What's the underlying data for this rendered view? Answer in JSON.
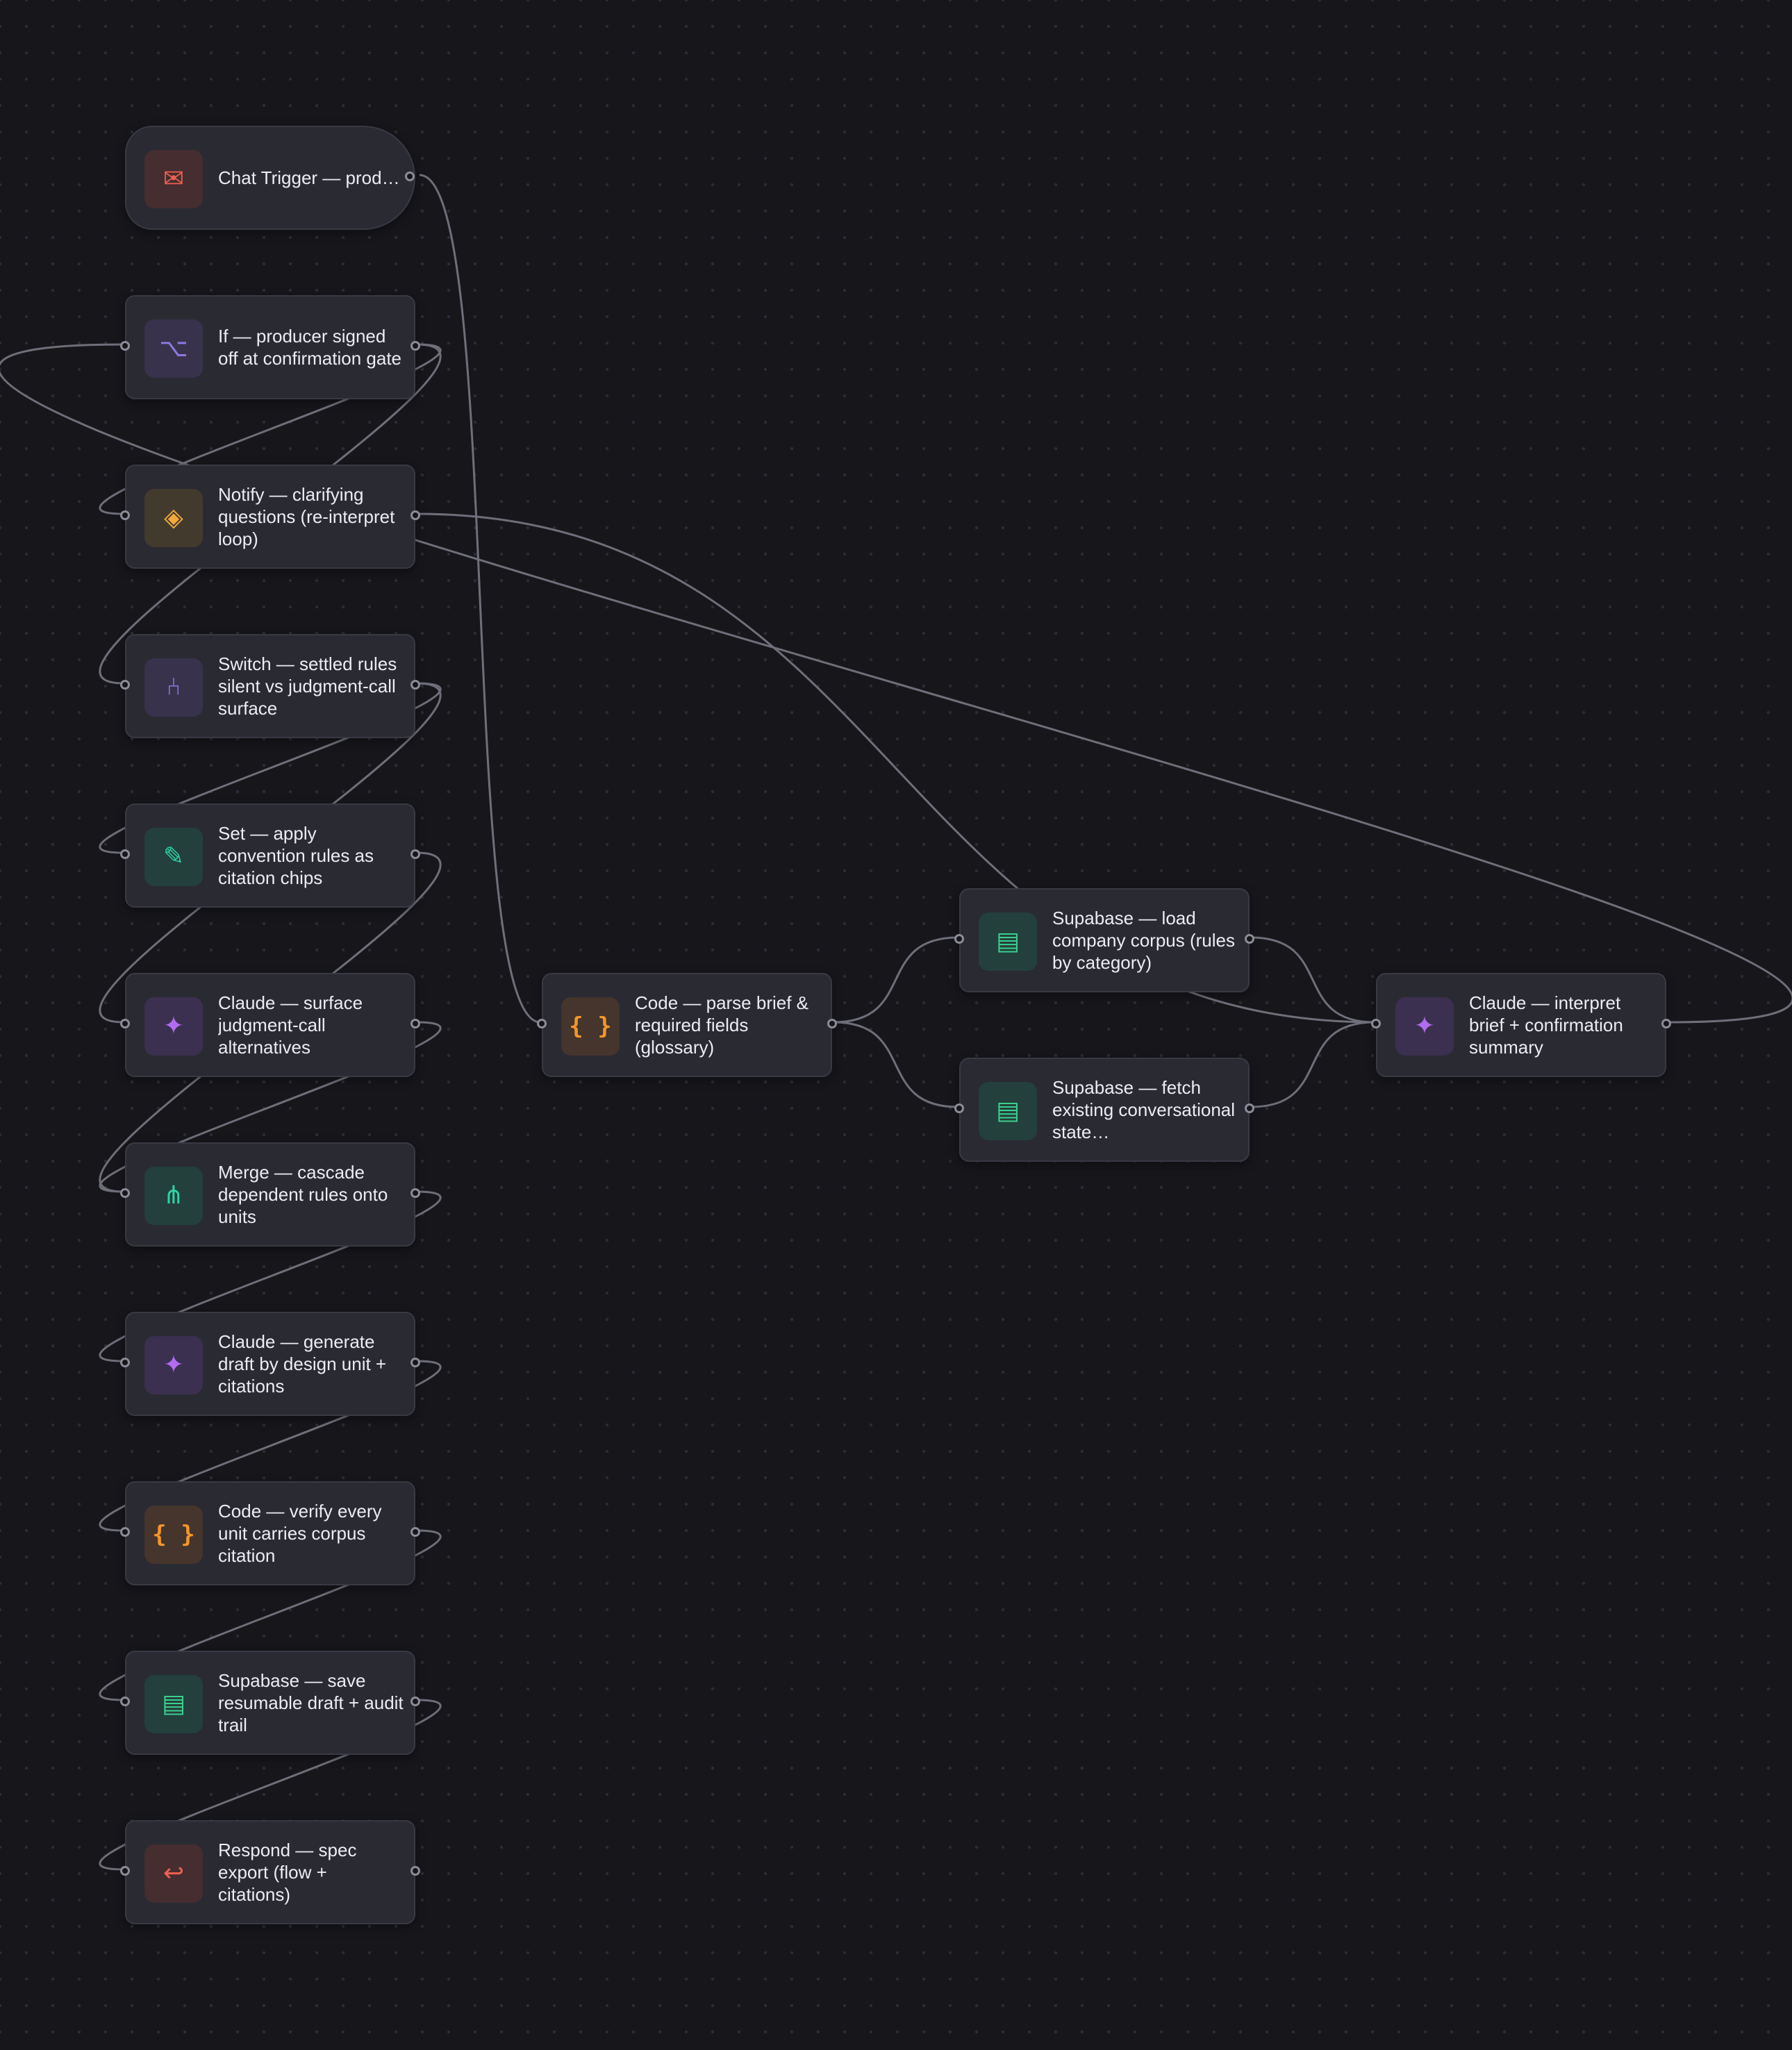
{
  "workflow": {
    "nodes": [
      {
        "id": "chat-trigger",
        "type": "trigger",
        "label": "Chat Trigger — producer brief (use case/channel/audience)",
        "icon": "envelope-icon",
        "glyph": "✉",
        "accent": "#f0604f",
        "tile": "#452d30",
        "has_input": false
      },
      {
        "id": "if-signoff",
        "type": "if",
        "label": "If — producer signed off at confirmation gate",
        "icon": "branch-icon",
        "glyph": "⌥",
        "accent": "#8e78e0",
        "tile": "#38324c",
        "has_input": true
      },
      {
        "id": "notify-clarify",
        "type": "notify",
        "label": "Notify — clarifying questions (re-interpret loop)",
        "icon": "diamond-icon",
        "glyph": "◈",
        "accent": "#f2a93b",
        "tile": "#433a2e",
        "has_input": true
      },
      {
        "id": "switch-rules",
        "type": "switch",
        "label": "Switch — settled rules silent vs judgment-call surface",
        "icon": "fork-icon",
        "glyph": "⑃",
        "accent": "#8e78e0",
        "tile": "#38324c",
        "has_input": true
      },
      {
        "id": "set-citation",
        "type": "set",
        "label": "Set — apply convention rules as citation chips",
        "icon": "pencil-icon",
        "glyph": "✎",
        "accent": "#2fd3a4",
        "tile": "#23403c",
        "has_input": true
      },
      {
        "id": "claude-alternatives",
        "type": "claude",
        "label": "Claude — surface judgment-call alternatives",
        "icon": "sparkle-icon",
        "glyph": "✦",
        "accent": "#b26cf2",
        "tile": "#3b3050",
        "has_input": true
      },
      {
        "id": "merge-cascade",
        "type": "merge",
        "label": "Merge — cascade dependent rules onto units",
        "icon": "merge-icon",
        "glyph": "⋔",
        "accent": "#2fd3a4",
        "tile": "#23403c",
        "has_input": true
      },
      {
        "id": "claude-draft",
        "type": "claude",
        "label": "Claude — generate draft by design unit + citations",
        "icon": "sparkle-icon",
        "glyph": "✦",
        "accent": "#b26cf2",
        "tile": "#3b3050",
        "has_input": true
      },
      {
        "id": "code-verify",
        "type": "code",
        "label": "Code — verify every unit carries corpus citation",
        "icon": "braces-icon",
        "glyph": "{ }",
        "accent": "#f5962a",
        "tile": "#45352c",
        "has_input": true
      },
      {
        "id": "supabase-save",
        "type": "supabase",
        "label": "Supabase — save resumable draft + audit trail",
        "icon": "database-icon",
        "glyph": "▤",
        "accent": "#3ccf8e",
        "tile": "#23403c",
        "has_input": true
      },
      {
        "id": "respond-export",
        "type": "respond",
        "label": "Respond — spec export (flow + citations)",
        "icon": "return-arrow-icon",
        "glyph": "↩",
        "accent": "#f0604f",
        "tile": "#452d30",
        "has_input": true
      },
      {
        "id": "code-parse",
        "type": "code",
        "label": "Code — parse brief & required fields (glossary)",
        "icon": "braces-icon",
        "glyph": "{ }",
        "accent": "#f5962a",
        "tile": "#45352c",
        "has_input": true
      },
      {
        "id": "supabase-corpus",
        "type": "supabase",
        "label": "Supabase — load company corpus (rules by category)",
        "icon": "database-icon",
        "glyph": "▤",
        "accent": "#3ccf8e",
        "tile": "#23403c",
        "has_input": true
      },
      {
        "id": "supabase-state",
        "type": "supabase",
        "label": "Supabase — fetch existing conversational state…",
        "icon": "database-icon",
        "glyph": "▤",
        "accent": "#3ccf8e",
        "tile": "#23403c",
        "has_input": true
      },
      {
        "id": "claude-interpret",
        "type": "claude",
        "label": "Claude — interpret brief + confirmation summary",
        "icon": "sparkle-icon",
        "glyph": "✦",
        "accent": "#b26cf2",
        "tile": "#3b3050",
        "has_input": true
      }
    ],
    "connections": [
      {
        "from": "chat-trigger",
        "to": "code-parse"
      },
      {
        "from": "code-parse",
        "to": "supabase-corpus"
      },
      {
        "from": "code-parse",
        "to": "supabase-state"
      },
      {
        "from": "supabase-corpus",
        "to": "claude-interpret"
      },
      {
        "from": "supabase-state",
        "to": "claude-interpret"
      },
      {
        "from": "claude-interpret",
        "to": "if-signoff"
      },
      {
        "from": "if-signoff",
        "to": "switch-rules"
      },
      {
        "from": "if-signoff",
        "to": "notify-clarify"
      },
      {
        "from": "notify-clarify",
        "to": "claude-interpret"
      },
      {
        "from": "switch-rules",
        "to": "set-citation"
      },
      {
        "from": "switch-rules",
        "to": "claude-alternatives"
      },
      {
        "from": "set-citation",
        "to": "merge-cascade"
      },
      {
        "from": "claude-alternatives",
        "to": "merge-cascade"
      },
      {
        "from": "merge-cascade",
        "to": "claude-draft"
      },
      {
        "from": "claude-draft",
        "to": "code-verify"
      },
      {
        "from": "code-verify",
        "to": "supabase-save"
      },
      {
        "from": "supabase-save",
        "to": "respond-export"
      }
    ],
    "colors": {
      "background": "#16161b",
      "node_fill": "#2a2a33",
      "node_border": "#393943",
      "edge": "#6f6f7a",
      "port": "#8c8c98",
      "text": "#ececf1"
    }
  }
}
